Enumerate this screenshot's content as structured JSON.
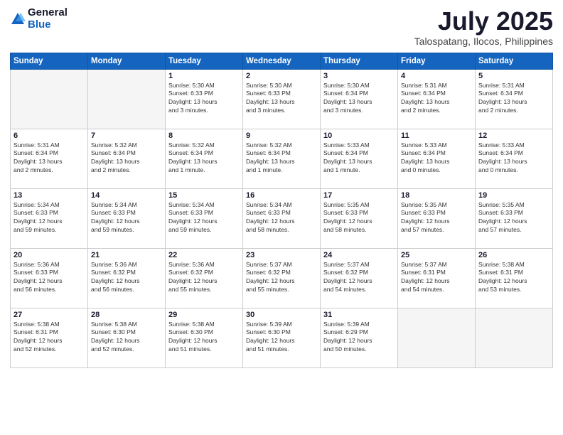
{
  "logo": {
    "general": "General",
    "blue": "Blue"
  },
  "title": "July 2025",
  "location": "Talospatang, Ilocos, Philippines",
  "weekdays": [
    "Sunday",
    "Monday",
    "Tuesday",
    "Wednesday",
    "Thursday",
    "Friday",
    "Saturday"
  ],
  "weeks": [
    [
      {
        "day": "",
        "info": ""
      },
      {
        "day": "",
        "info": ""
      },
      {
        "day": "1",
        "info": "Sunrise: 5:30 AM\nSunset: 6:33 PM\nDaylight: 13 hours\nand 3 minutes."
      },
      {
        "day": "2",
        "info": "Sunrise: 5:30 AM\nSunset: 6:33 PM\nDaylight: 13 hours\nand 3 minutes."
      },
      {
        "day": "3",
        "info": "Sunrise: 5:30 AM\nSunset: 6:34 PM\nDaylight: 13 hours\nand 3 minutes."
      },
      {
        "day": "4",
        "info": "Sunrise: 5:31 AM\nSunset: 6:34 PM\nDaylight: 13 hours\nand 2 minutes."
      },
      {
        "day": "5",
        "info": "Sunrise: 5:31 AM\nSunset: 6:34 PM\nDaylight: 13 hours\nand 2 minutes."
      }
    ],
    [
      {
        "day": "6",
        "info": "Sunrise: 5:31 AM\nSunset: 6:34 PM\nDaylight: 13 hours\nand 2 minutes."
      },
      {
        "day": "7",
        "info": "Sunrise: 5:32 AM\nSunset: 6:34 PM\nDaylight: 13 hours\nand 2 minutes."
      },
      {
        "day": "8",
        "info": "Sunrise: 5:32 AM\nSunset: 6:34 PM\nDaylight: 13 hours\nand 1 minute."
      },
      {
        "day": "9",
        "info": "Sunrise: 5:32 AM\nSunset: 6:34 PM\nDaylight: 13 hours\nand 1 minute."
      },
      {
        "day": "10",
        "info": "Sunrise: 5:33 AM\nSunset: 6:34 PM\nDaylight: 13 hours\nand 1 minute."
      },
      {
        "day": "11",
        "info": "Sunrise: 5:33 AM\nSunset: 6:34 PM\nDaylight: 13 hours\nand 0 minutes."
      },
      {
        "day": "12",
        "info": "Sunrise: 5:33 AM\nSunset: 6:34 PM\nDaylight: 13 hours\nand 0 minutes."
      }
    ],
    [
      {
        "day": "13",
        "info": "Sunrise: 5:34 AM\nSunset: 6:33 PM\nDaylight: 12 hours\nand 59 minutes."
      },
      {
        "day": "14",
        "info": "Sunrise: 5:34 AM\nSunset: 6:33 PM\nDaylight: 12 hours\nand 59 minutes."
      },
      {
        "day": "15",
        "info": "Sunrise: 5:34 AM\nSunset: 6:33 PM\nDaylight: 12 hours\nand 59 minutes."
      },
      {
        "day": "16",
        "info": "Sunrise: 5:34 AM\nSunset: 6:33 PM\nDaylight: 12 hours\nand 58 minutes."
      },
      {
        "day": "17",
        "info": "Sunrise: 5:35 AM\nSunset: 6:33 PM\nDaylight: 12 hours\nand 58 minutes."
      },
      {
        "day": "18",
        "info": "Sunrise: 5:35 AM\nSunset: 6:33 PM\nDaylight: 12 hours\nand 57 minutes."
      },
      {
        "day": "19",
        "info": "Sunrise: 5:35 AM\nSunset: 6:33 PM\nDaylight: 12 hours\nand 57 minutes."
      }
    ],
    [
      {
        "day": "20",
        "info": "Sunrise: 5:36 AM\nSunset: 6:33 PM\nDaylight: 12 hours\nand 56 minutes."
      },
      {
        "day": "21",
        "info": "Sunrise: 5:36 AM\nSunset: 6:32 PM\nDaylight: 12 hours\nand 56 minutes."
      },
      {
        "day": "22",
        "info": "Sunrise: 5:36 AM\nSunset: 6:32 PM\nDaylight: 12 hours\nand 55 minutes."
      },
      {
        "day": "23",
        "info": "Sunrise: 5:37 AM\nSunset: 6:32 PM\nDaylight: 12 hours\nand 55 minutes."
      },
      {
        "day": "24",
        "info": "Sunrise: 5:37 AM\nSunset: 6:32 PM\nDaylight: 12 hours\nand 54 minutes."
      },
      {
        "day": "25",
        "info": "Sunrise: 5:37 AM\nSunset: 6:31 PM\nDaylight: 12 hours\nand 54 minutes."
      },
      {
        "day": "26",
        "info": "Sunrise: 5:38 AM\nSunset: 6:31 PM\nDaylight: 12 hours\nand 53 minutes."
      }
    ],
    [
      {
        "day": "27",
        "info": "Sunrise: 5:38 AM\nSunset: 6:31 PM\nDaylight: 12 hours\nand 52 minutes."
      },
      {
        "day": "28",
        "info": "Sunrise: 5:38 AM\nSunset: 6:30 PM\nDaylight: 12 hours\nand 52 minutes."
      },
      {
        "day": "29",
        "info": "Sunrise: 5:38 AM\nSunset: 6:30 PM\nDaylight: 12 hours\nand 51 minutes."
      },
      {
        "day": "30",
        "info": "Sunrise: 5:39 AM\nSunset: 6:30 PM\nDaylight: 12 hours\nand 51 minutes."
      },
      {
        "day": "31",
        "info": "Sunrise: 5:39 AM\nSunset: 6:29 PM\nDaylight: 12 hours\nand 50 minutes."
      },
      {
        "day": "",
        "info": ""
      },
      {
        "day": "",
        "info": ""
      }
    ]
  ]
}
